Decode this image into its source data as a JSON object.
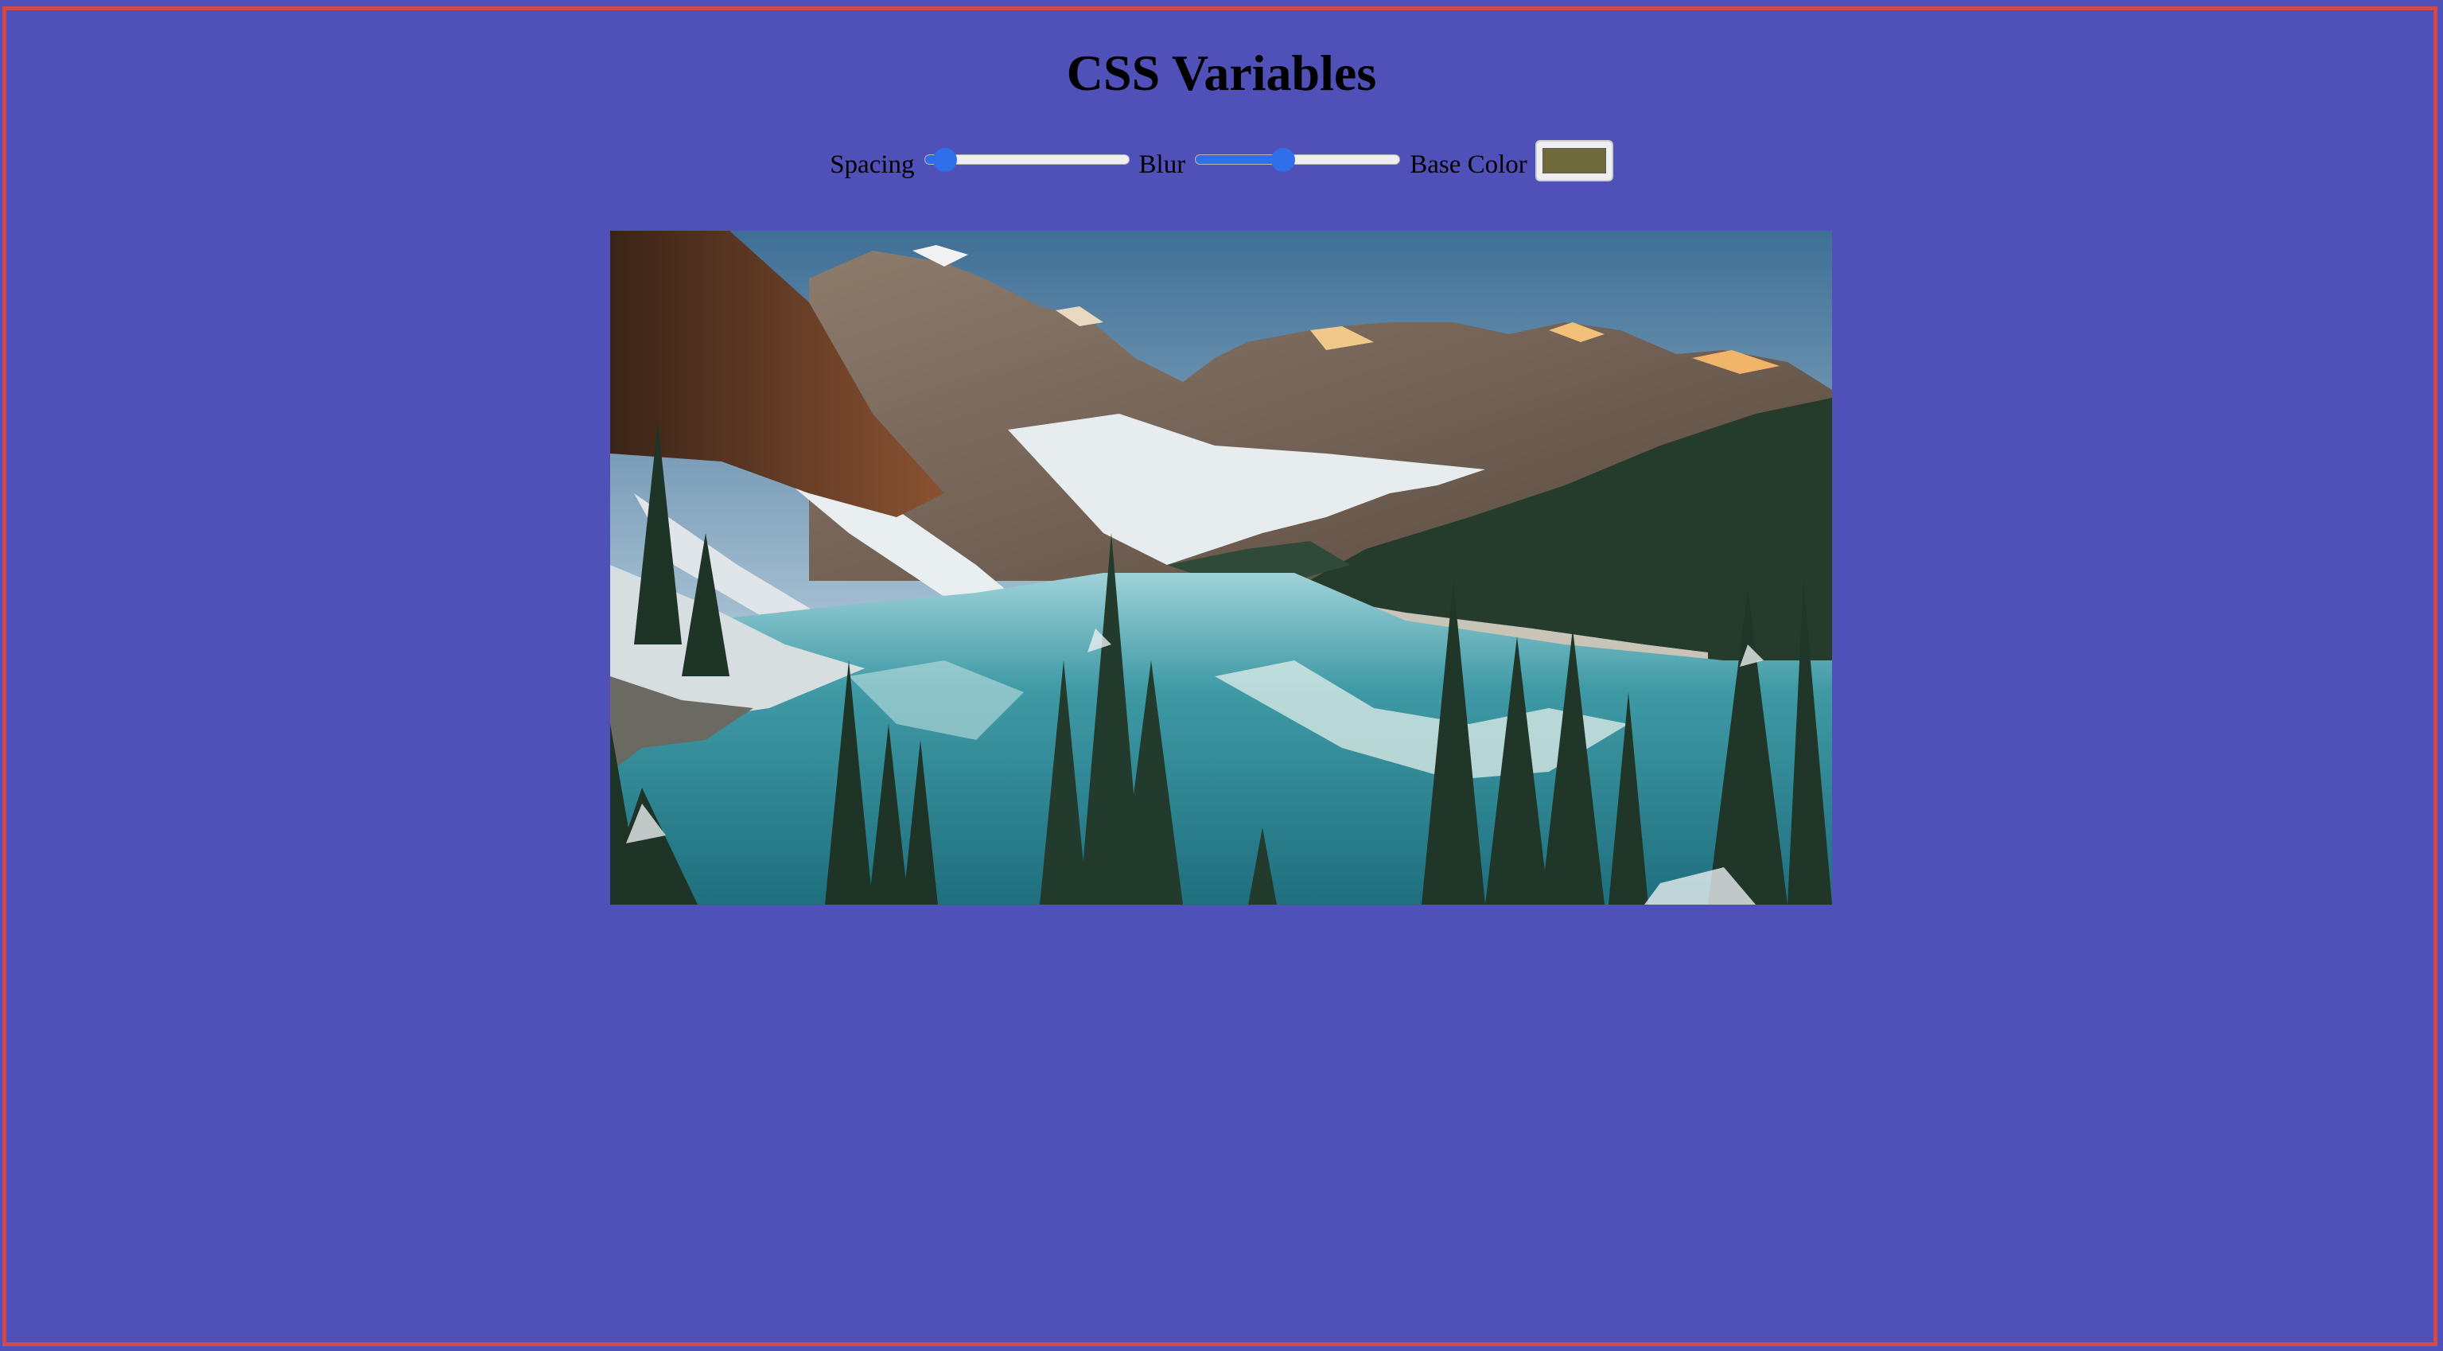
{
  "page": {
    "title": "CSS Variables",
    "background_color": "#5051b8",
    "frame_color": "#d24a4a"
  },
  "controls": {
    "spacing": {
      "label": "Spacing",
      "value": 0.05
    },
    "blur": {
      "label": "Blur",
      "value": 0.42
    },
    "base_color": {
      "label": "Base Color",
      "value": "#6f6a3c"
    }
  },
  "image": {
    "subject": "mountain-lake-landscape",
    "accent_color": "#2f8e9a"
  }
}
